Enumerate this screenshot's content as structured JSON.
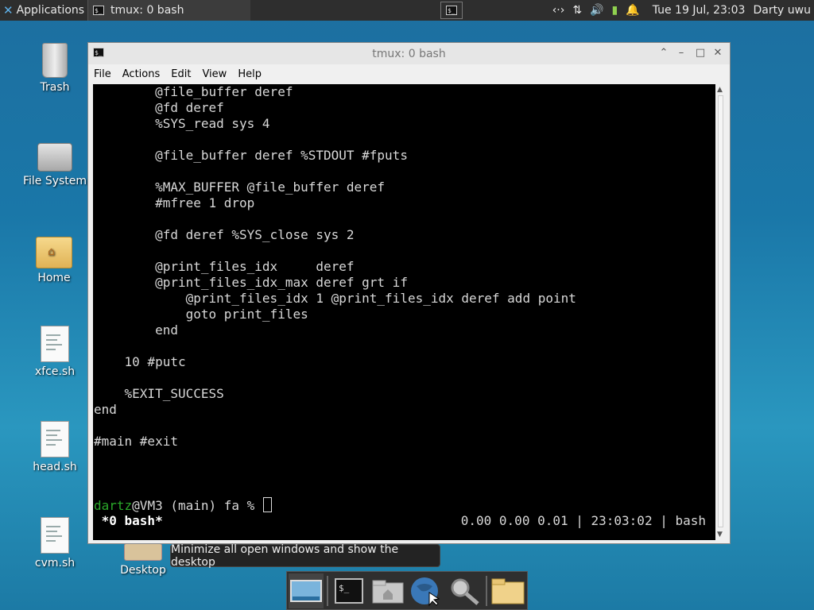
{
  "top_panel": {
    "applications_label": "Applications",
    "task_title": "tmux: 0 bash",
    "clock": "Tue 19 Jul, 23:03",
    "user": "Darty uwu"
  },
  "desktop": {
    "icons": [
      {
        "label": "Trash"
      },
      {
        "label": "File System"
      },
      {
        "label": "Home"
      },
      {
        "label": "xfce.sh"
      },
      {
        "label": "head.sh"
      },
      {
        "label": "cvm.sh"
      },
      {
        "label": "Desktop"
      }
    ]
  },
  "window": {
    "title": "tmux: 0 bash",
    "menu": [
      "File",
      "Actions",
      "Edit",
      "View",
      "Help"
    ]
  },
  "terminal": {
    "lines": [
      "        @file_buffer deref",
      "        @fd deref",
      "        %SYS_read sys 4",
      "",
      "        @file_buffer deref %STDOUT #fputs",
      "",
      "        %MAX_BUFFER @file_buffer deref",
      "        #mfree 1 drop",
      "",
      "        @fd deref %SYS_close sys 2",
      "",
      "        @print_files_idx     deref",
      "        @print_files_idx_max deref grt if",
      "            @print_files_idx 1 @print_files_idx deref add point",
      "            goto print_files",
      "        end",
      "",
      "    10 #putc",
      "",
      "    %EXIT_SUCCESS",
      "end",
      "",
      "#main #exit",
      "",
      ""
    ],
    "prompt_user": "dartz",
    "prompt_rest": "@VM3 (main) fa % ",
    "status_left": " *0 bash*",
    "status_right": "0.00 0.00 0.01 | 23:03:02 | bash"
  },
  "tooltip": {
    "text": "Minimize all open windows and show the desktop"
  },
  "colors": {
    "prompt_green": "#2aa82a",
    "terminal_bg": "#000000"
  }
}
